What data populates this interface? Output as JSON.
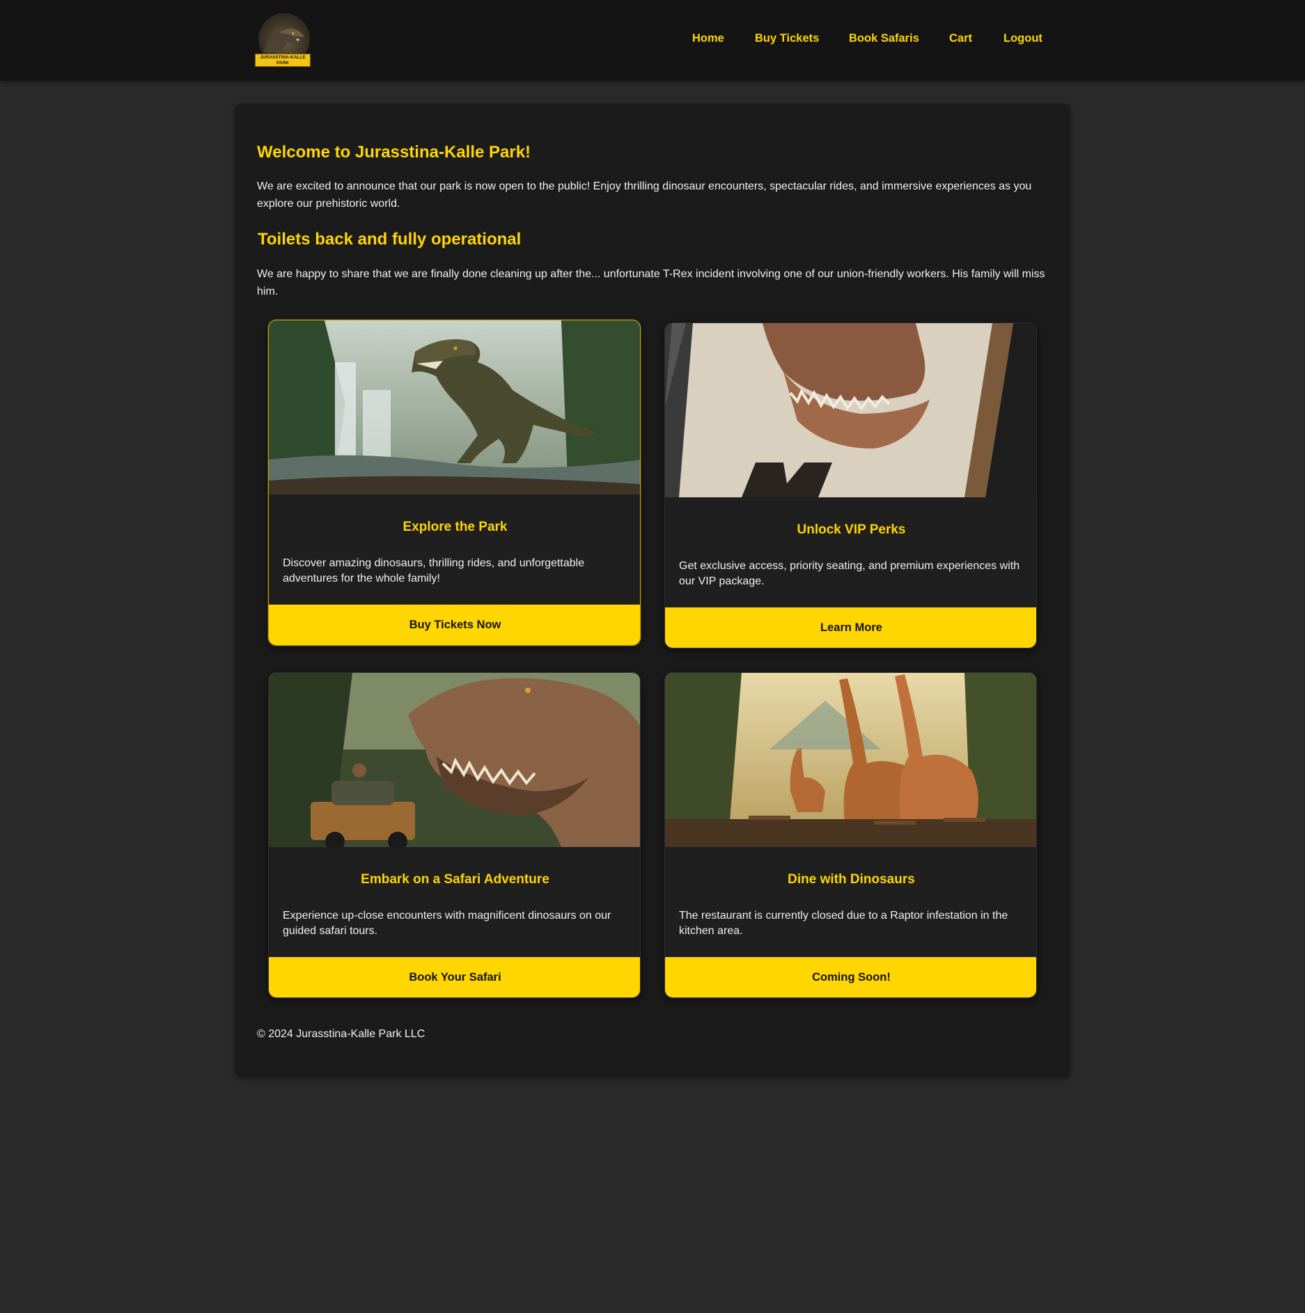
{
  "header": {
    "logo_text": "JURASSTINA-KALLE PARK",
    "nav": [
      {
        "label": "Home"
      },
      {
        "label": "Buy Tickets"
      },
      {
        "label": "Book Safaris"
      },
      {
        "label": "Cart"
      },
      {
        "label": "Logout"
      }
    ]
  },
  "main": {
    "welcome_title": "Welcome to Jurasstina-Kalle Park!",
    "welcome_text": "We are excited to announce that our park is now open to the public! Enjoy thrilling dinosaur encounters, spectacular rides, and immersive experiences as you explore our prehistoric world.",
    "news_title": "Toilets back and fully operational",
    "news_text": "We are happy to share that we are finally done cleaning up after the... unfortunate T-Rex incident involving one of our union-friendly workers. His family will miss him."
  },
  "cards": [
    {
      "title": "Explore the Park",
      "text": "Discover amazing dinosaurs, thrilling rides, and unforgettable adventures for the whole family!",
      "button": "Buy Tickets Now",
      "image": "trex-jungle-waterfall"
    },
    {
      "title": "Unlock VIP Perks",
      "text": "Get exclusive access, priority seating, and premium experiences with our VIP package.",
      "button": "Learn More",
      "image": "vip-ticket-trex"
    },
    {
      "title": "Embark on a Safari Adventure",
      "text": "Experience up-close encounters with magnificent dinosaurs on our guided safari tours.",
      "button": "Book Your Safari",
      "image": "safari-jeep-trex"
    },
    {
      "title": "Dine with Dinosaurs",
      "text": "The restaurant is currently closed due to a Raptor infestation in the kitchen area.",
      "button": "Coming Soon!",
      "image": "jungle-restaurant-sauropods"
    }
  ],
  "footer": {
    "text": "© 2024 Jurasstina-Kalle Park LLC"
  },
  "colors": {
    "accent": "#ffd600",
    "page_bg": "#2a2a2a",
    "panel_bg": "#1b1b1b",
    "header_bg": "#141414"
  }
}
